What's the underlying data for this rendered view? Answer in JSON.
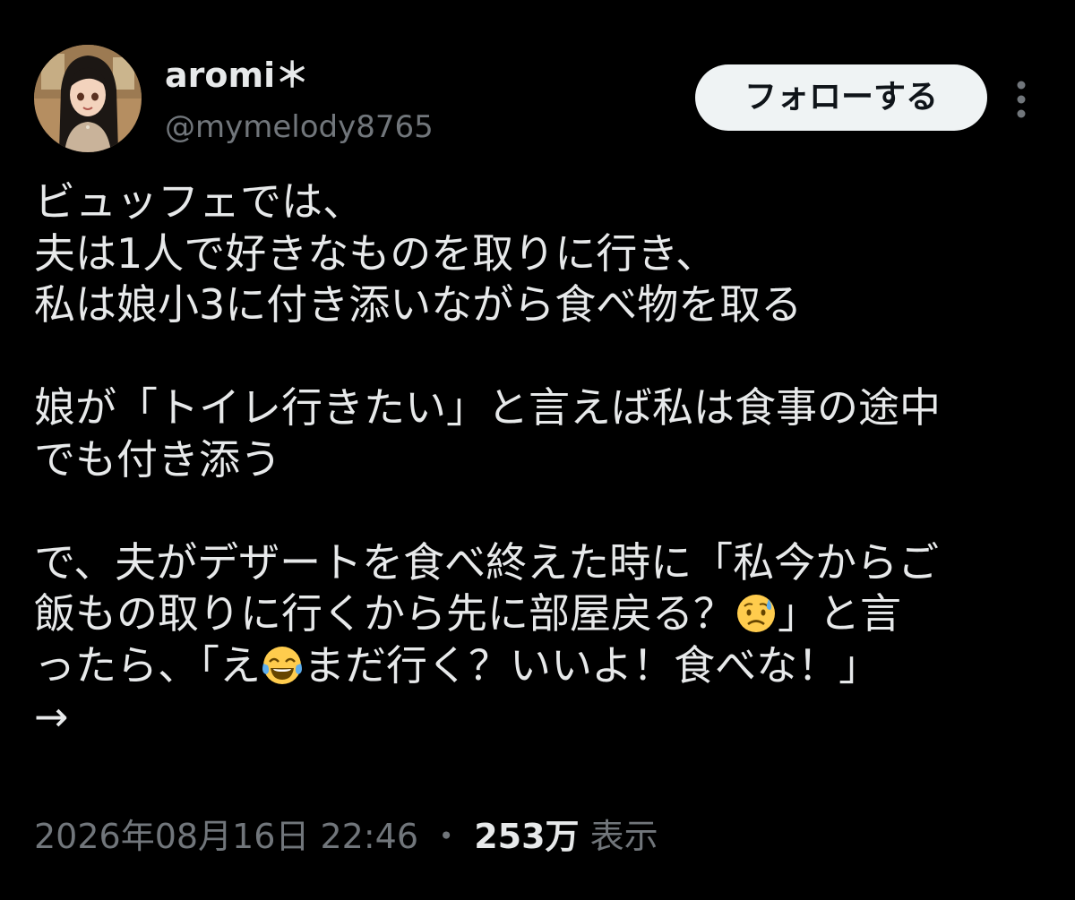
{
  "author": {
    "display_name": "aromi＊",
    "handle": "@mymelody8765",
    "avatar_icon": "user-avatar-icon"
  },
  "header": {
    "follow_label": "フォローする",
    "more_icon": "more-options-icon"
  },
  "tweet": {
    "lines": {
      "l1": "ビュッフェでは、",
      "l2": "夫は1人で好きなものを取りに行き、",
      "l3": "私は娘小3に付き添いながら食べ物を取る",
      "l4": "娘が「トイレ行きたい」と言えば私は食事の途中",
      "l5": "でも付き添う",
      "l6": "で、夫がデザートを食べ終えた時に「私今からご",
      "l7a": "飯もの取りに行くから先に部屋戻る？",
      "l7b": "」と言",
      "l8a": "ったら、「え",
      "l8b": "まだ行く？いいよ！食べな！」",
      "l9": "→"
    },
    "emoji": {
      "first": "sad-sweat-face-emoji",
      "second": "tears-of-joy-emoji"
    }
  },
  "meta": {
    "timestamp": "2026年08月16日 22:46",
    "separator": "・",
    "view_count": "253万",
    "view_label": "表示"
  },
  "colors": {
    "background": "#000000",
    "primary_text": "#e7e9ea",
    "secondary_text": "#71767b",
    "follow_button_bg": "#eff3f4",
    "follow_button_text": "#0f1419"
  }
}
